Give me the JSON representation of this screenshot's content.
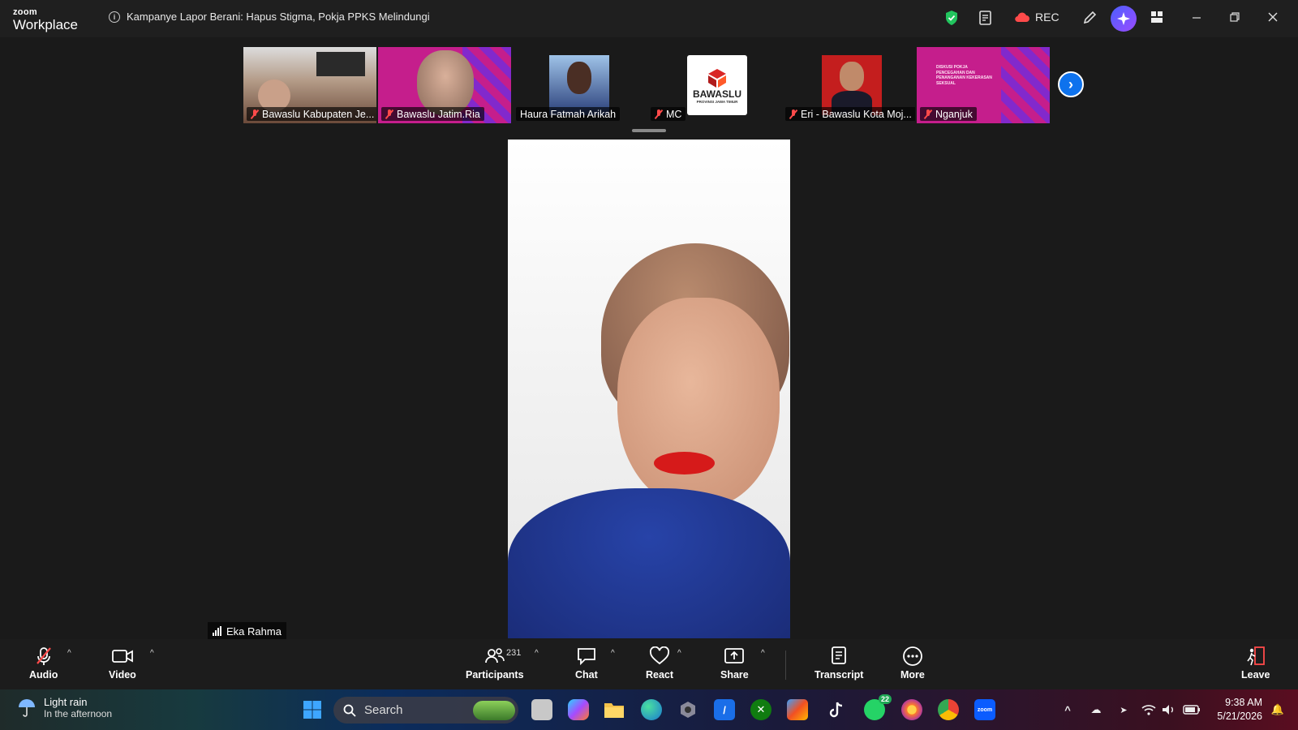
{
  "app": {
    "brand_line1": "zoom",
    "brand_line2": "Workplace",
    "meeting_title": "Kampanye Lapor Berani: Hapus Stigma, Pokja PPKS Melindungi",
    "rec_label": "REC"
  },
  "thumbnails": [
    {
      "name": "Bawaslu Kabupaten Je...",
      "muted": true,
      "kind": "camera"
    },
    {
      "name": "Bawaslu Jatim.Ria",
      "muted": true,
      "kind": "poster-person"
    },
    {
      "name": "Haura Fatmah Arikah",
      "muted": false,
      "kind": "photo"
    },
    {
      "name": "MC",
      "muted": true,
      "kind": "logo",
      "logo_text": "BAWASLU",
      "logo_sub": "PROVINSI JAWA TIMUR"
    },
    {
      "name": "Eri - Bawaslu Kota Moj...",
      "muted": true,
      "kind": "photo"
    },
    {
      "name": "Nganjuk",
      "muted": true,
      "kind": "poster"
    }
  ],
  "poster_text": "DISKUSI POKJA PENCEGAHAN DAN PENANGANAN KEKERASAN SEKSUAL",
  "active_speaker": "Eka Rahma",
  "controls": {
    "audio": "Audio",
    "video": "Video",
    "participants": "Participants",
    "participants_count": "231",
    "chat": "Chat",
    "react": "React",
    "share": "Share",
    "transcript": "Transcript",
    "more": "More",
    "leave": "Leave"
  },
  "taskbar": {
    "weather_title": "Light rain",
    "weather_sub": "In the afternoon",
    "search_placeholder": "Search",
    "whatsapp_badge": "22",
    "time": "9:38 AM",
    "date": "5/21/2026"
  },
  "colors": {
    "accent": "#0e72ed",
    "muted_red": "#ff4a4a",
    "poster_magenta": "#c51e8c",
    "shield_green": "#22c55e"
  }
}
